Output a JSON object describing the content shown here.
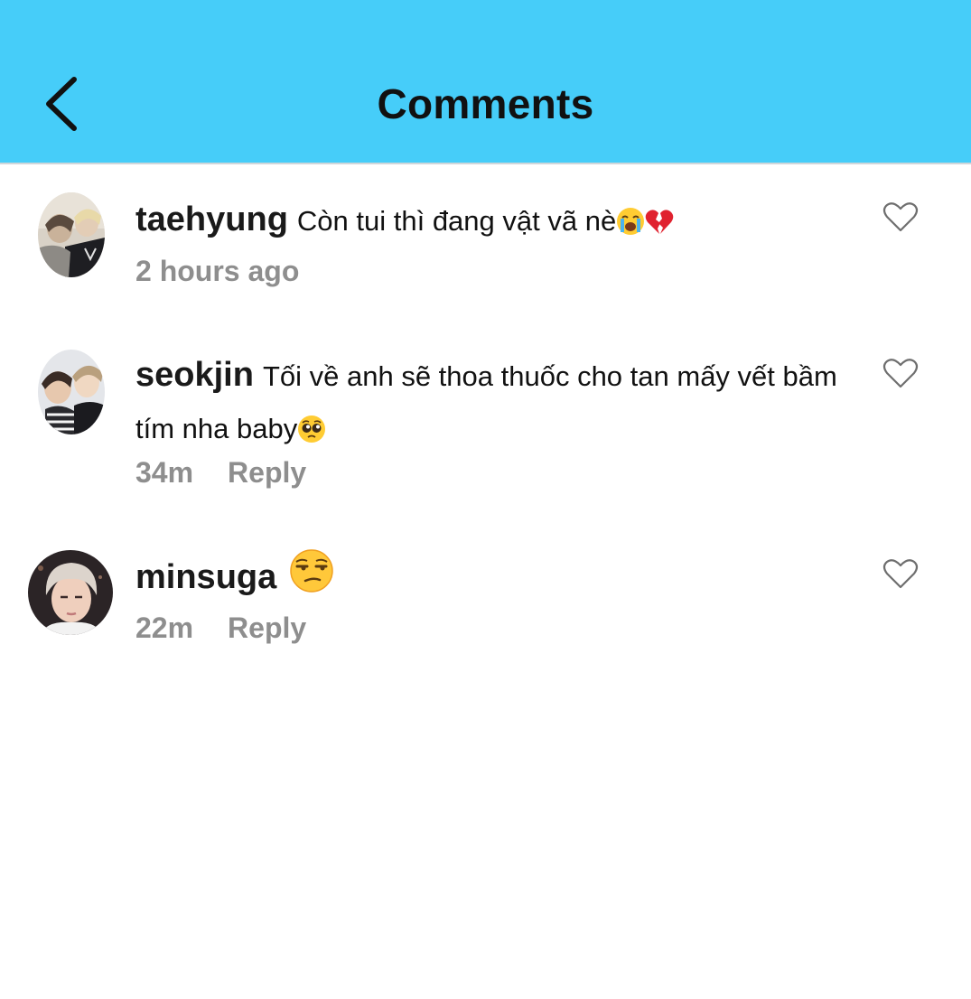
{
  "header": {
    "title": "Comments",
    "back_icon": "chevron-left-icon",
    "background_color": "#46cdf9"
  },
  "comments": [
    {
      "username": "taehyung",
      "text": "Còn tui thì đang vật vã nè",
      "emojis": [
        "loudly-crying-face",
        "broken-heart"
      ],
      "time": "2 hours ago",
      "reply_label": ""
    },
    {
      "username": "seokjin",
      "text": "Tối về anh sẽ thoa thuốc cho tan mấy vết bầm tím nha baby",
      "emojis": [
        "pleading-face"
      ],
      "time": "34m",
      "reply_label": "Reply"
    },
    {
      "username": "minsuga",
      "text": "",
      "emojis": [
        "unamused-face"
      ],
      "time": "22m",
      "reply_label": "Reply"
    }
  ],
  "like_icon": "heart-outline-icon",
  "meta_color": "#8e8e8e"
}
